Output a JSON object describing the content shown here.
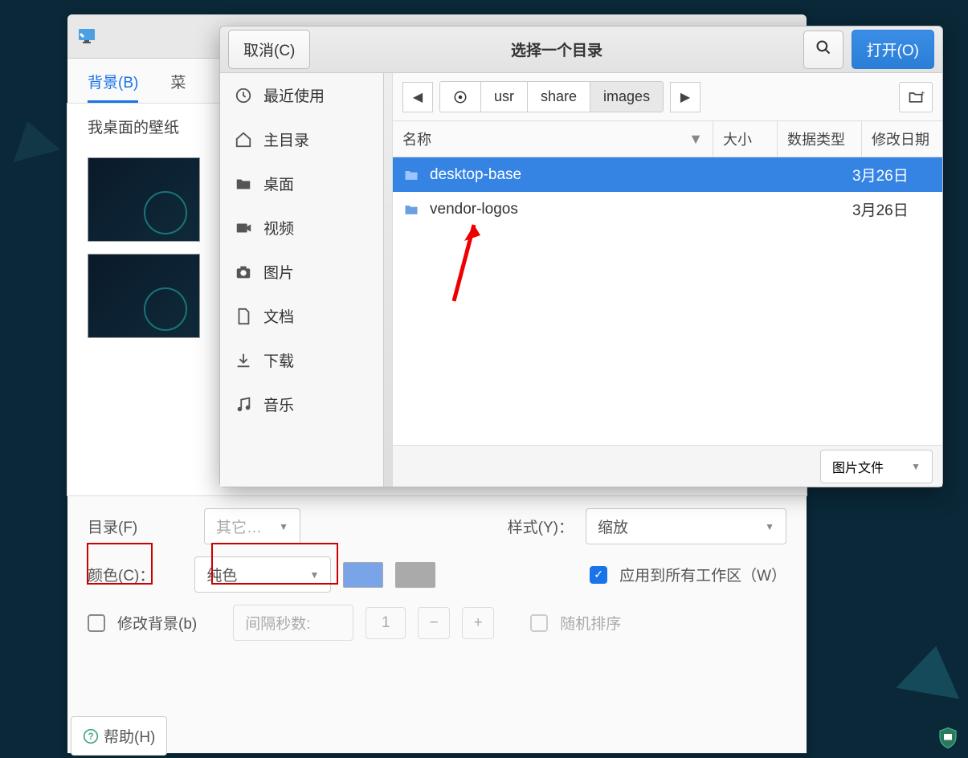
{
  "background_window": {
    "tabs": [
      "背景(B)",
      "菜"
    ],
    "heading": "我桌面的壁纸",
    "folder_label": "目录(F)",
    "folder_value": "其它…",
    "style_label": "样式(Y)：",
    "style_value": "缩放",
    "color_label": "颜色(C)：",
    "color_value": "纯色",
    "apply_all_label": "应用到所有工作区（W）",
    "modify_bg_label": "修改背景(b)",
    "interval_placeholder": "间隔秒数:",
    "interval_value": "1",
    "random_label": "随机排序",
    "help_label": "帮助(H)"
  },
  "chooser": {
    "cancel": "取消(C)",
    "title": "选择一个目录",
    "open": "打开(O)",
    "sidebar": [
      {
        "label": "最近使用",
        "icon": "clock"
      },
      {
        "label": "主目录",
        "icon": "home"
      },
      {
        "label": "桌面",
        "icon": "folder"
      },
      {
        "label": "视频",
        "icon": "video"
      },
      {
        "label": "图片",
        "icon": "camera"
      },
      {
        "label": "文档",
        "icon": "document"
      },
      {
        "label": "下载",
        "icon": "download"
      },
      {
        "label": "音乐",
        "icon": "music"
      }
    ],
    "breadcrumbs": [
      "usr",
      "share",
      "images"
    ],
    "columns": {
      "name": "名称",
      "size": "大小",
      "type": "数据类型",
      "date": "修改日期"
    },
    "files": [
      {
        "name": "desktop-base",
        "date": "3月26日",
        "selected": true
      },
      {
        "name": "vendor-logos",
        "date": "3月26日",
        "selected": false
      }
    ],
    "filter": "图片文件"
  }
}
